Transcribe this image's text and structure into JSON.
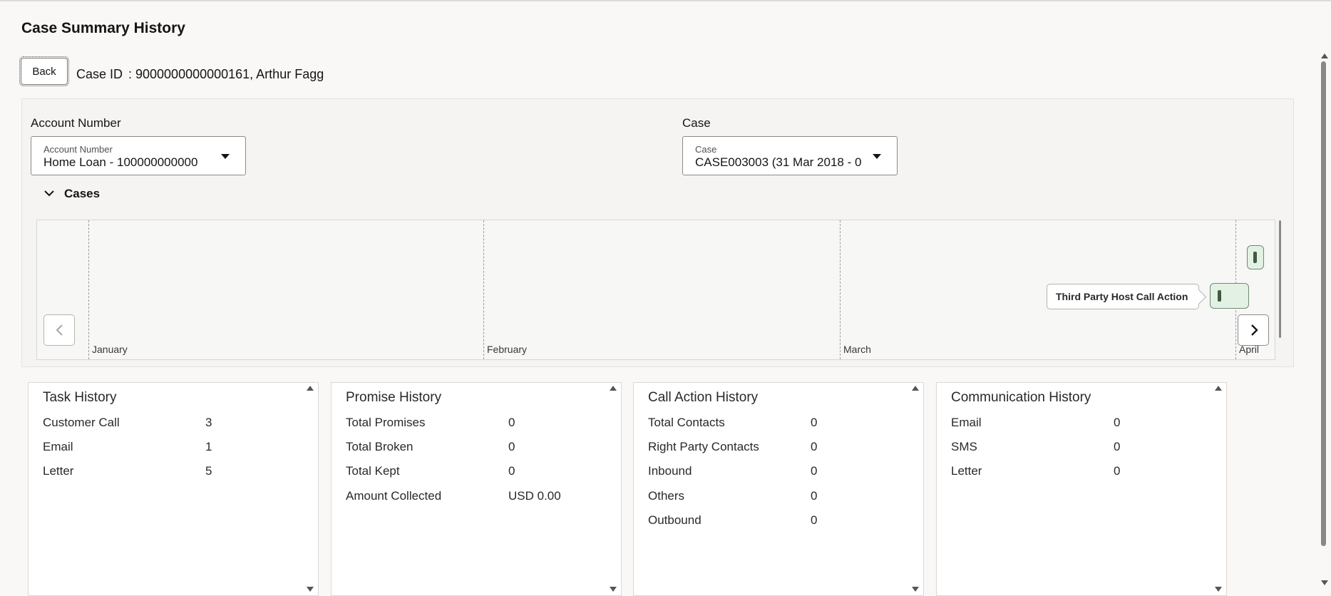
{
  "page": {
    "title": "Case Summary History",
    "back_label": "Back",
    "case_id_label": "Case ID",
    "case_id_value": ": 9000000000000161,  Arthur Fagg"
  },
  "filters": {
    "account": {
      "section_title": "Account Number",
      "field_label": "Account Number",
      "value": "Home Loan - 100000000000"
    },
    "case": {
      "section_title": "Case",
      "field_label": "Case",
      "value": "CASE003003 (31 Mar 2018 - 0"
    }
  },
  "cases_section": {
    "label": "Cases",
    "expanded": true,
    "icons": {
      "toggle": "chevron-down-icon",
      "prev": "chevron-left-icon",
      "next": "chevron-right-icon"
    },
    "timeline": {
      "months": [
        "January",
        "February",
        "March",
        "April"
      ],
      "event_tooltip": "Third Party Host Call Action",
      "event_color": "#e3f1e4"
    }
  },
  "cards": {
    "task": {
      "title": "Task History",
      "rows": [
        {
          "label": "Customer Call",
          "value": "3"
        },
        {
          "label": "Email",
          "value": "1"
        },
        {
          "label": "Letter",
          "value": "5"
        }
      ]
    },
    "promise": {
      "title": "Promise History",
      "rows": [
        {
          "label": "Total Promises",
          "value": "0"
        },
        {
          "label": "Total Broken",
          "value": "0"
        },
        {
          "label": "Total Kept",
          "value": "0"
        },
        {
          "label": "Amount Collected",
          "value": "USD 0.00"
        }
      ]
    },
    "call_action": {
      "title": "Call Action History",
      "rows": [
        {
          "label": "Total Contacts",
          "value": "0"
        },
        {
          "label": "Right Party Contacts",
          "value": "0"
        },
        {
          "label": "Inbound",
          "value": "0"
        },
        {
          "label": "Others",
          "value": "0"
        },
        {
          "label": "Outbound",
          "value": "0"
        }
      ]
    },
    "communication": {
      "title": "Communication History",
      "rows": [
        {
          "label": "Email",
          "value": "0"
        },
        {
          "label": "SMS",
          "value": "0"
        },
        {
          "label": "Letter",
          "value": "0"
        }
      ]
    }
  }
}
